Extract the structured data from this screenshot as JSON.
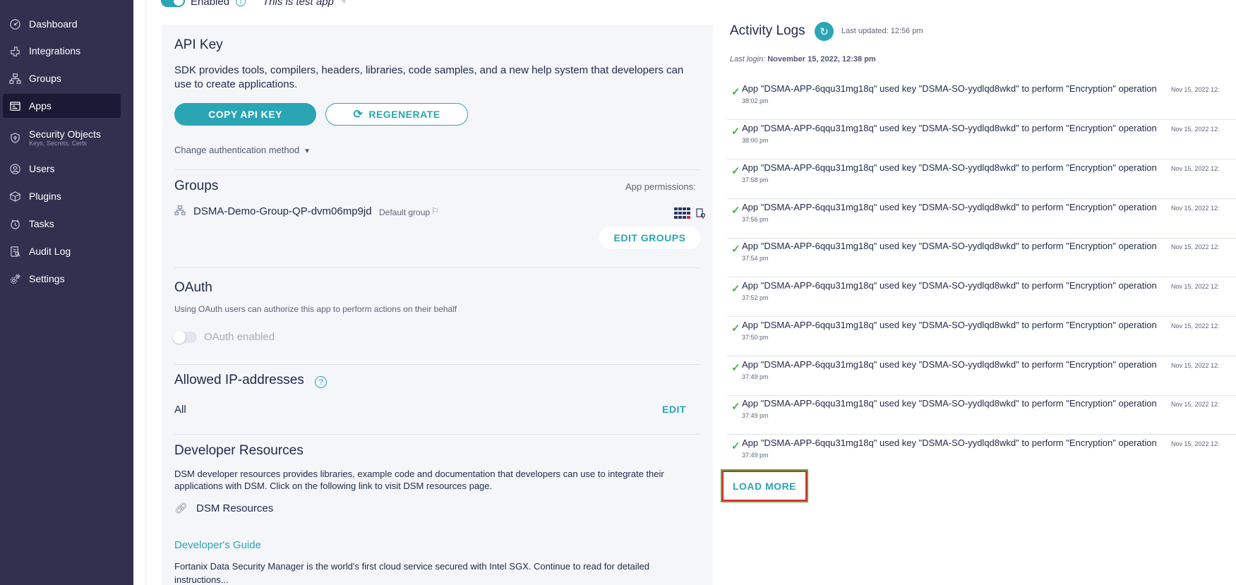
{
  "sidebar": {
    "items": [
      {
        "label": "Dashboard",
        "icon": "dashboard-icon"
      },
      {
        "label": "Integrations",
        "icon": "integrations-icon"
      },
      {
        "label": "Groups",
        "icon": "groups-icon"
      },
      {
        "label": "Apps",
        "icon": "apps-icon",
        "active": true
      },
      {
        "label": "Security Objects",
        "sublabel": "Keys, Secrets, Certs",
        "icon": "security-objects-icon"
      },
      {
        "label": "Users",
        "icon": "users-icon"
      },
      {
        "label": "Plugins",
        "icon": "plugins-icon"
      },
      {
        "label": "Tasks",
        "icon": "tasks-icon"
      },
      {
        "label": "Audit Log",
        "icon": "audit-log-icon"
      },
      {
        "label": "Settings",
        "icon": "settings-icon"
      }
    ]
  },
  "app_header": {
    "enabled_label": "Enabled",
    "description": "This is test app"
  },
  "api_key": {
    "title": "API Key",
    "description": "SDK provides tools, compilers, headers, libraries, code samples, and a new help system that developers can use to create applications.",
    "copy_label": "COPY API KEY",
    "regenerate_label": "REGENERATE",
    "change_auth_label": "Change authentication method"
  },
  "groups": {
    "title": "Groups",
    "permissions_label": "App permissions:",
    "group_name": "DSMA-Demo-Group-QP-dvm06mp9jd",
    "default_label": "Default group",
    "edit_label": "EDIT GROUPS"
  },
  "oauth": {
    "title": "OAuth",
    "description": "Using OAuth users can authorize this app to perform actions on their behalf",
    "toggle_label": "OAuth enabled"
  },
  "allowed_ip": {
    "title": "Allowed IP-addresses",
    "value": "All",
    "edit_label": "EDIT"
  },
  "developer_resources": {
    "title": "Developer Resources",
    "description": "DSM developer resources provides libraries, example code and documentation that developers can use to integrate their applications with DSM. Click on the following link to visit DSM resources page.",
    "link_label": "DSM Resources",
    "guide_title": "Developer's Guide",
    "guide_text": "Fortanix Data Security Manager is the world's first cloud service secured with Intel SGX. Continue to read for detailed instructions..."
  },
  "activity_logs": {
    "title": "Activity Logs",
    "last_updated": "Last updated: 12:56 pm",
    "last_login_label": "Last login:",
    "last_login_value": "November 15, 2022, 12:38 pm",
    "load_more_label": "LOAD MORE",
    "entries": [
      {
        "message": "App \"DSMA-APP-6qqu31mg18q\" used key \"DSMA-SO-yydlqd8wkd\" to perform \"Encryption\" operation",
        "date": "Nov 15, 2022 12:",
        "time": "38:02 pm"
      },
      {
        "message": "App \"DSMA-APP-6qqu31mg18q\" used key \"DSMA-SO-yydlqd8wkd\" to perform \"Encryption\" operation",
        "date": "Nov 15, 2022 12:",
        "time": "38:00 pm"
      },
      {
        "message": "App \"DSMA-APP-6qqu31mg18q\" used key \"DSMA-SO-yydlqd8wkd\" to perform \"Encryption\" operation",
        "date": "Nov 15, 2022 12:",
        "time": "37:58 pm"
      },
      {
        "message": "App \"DSMA-APP-6qqu31mg18q\" used key \"DSMA-SO-yydlqd8wkd\" to perform \"Encryption\" operation",
        "date": "Nov 15, 2022 12:",
        "time": "37:56 pm"
      },
      {
        "message": "App \"DSMA-APP-6qqu31mg18q\" used key \"DSMA-SO-yydlqd8wkd\" to perform \"Encryption\" operation",
        "date": "Nov 15, 2022 12:",
        "time": "37:54 pm"
      },
      {
        "message": "App \"DSMA-APP-6qqu31mg18q\" used key \"DSMA-SO-yydlqd8wkd\" to perform \"Encryption\" operation",
        "date": "Nov 15, 2022 12:",
        "time": "37:52 pm"
      },
      {
        "message": "App \"DSMA-APP-6qqu31mg18q\" used key \"DSMA-SO-yydlqd8wkd\" to perform \"Encryption\" operation",
        "date": "Nov 15, 2022 12:",
        "time": "37:50 pm"
      },
      {
        "message": "App \"DSMA-APP-6qqu31mg18q\" used key \"DSMA-SO-yydlqd8wkd\" to perform \"Encryption\" operation",
        "date": "Nov 15, 2022 12:",
        "time": "37:49 pm"
      },
      {
        "message": "App \"DSMA-APP-6qqu31mg18q\" used key \"DSMA-SO-yydlqd8wkd\" to perform \"Encryption\" operation",
        "date": "Nov 15, 2022 12:",
        "time": "37:49 pm"
      },
      {
        "message": "App \"DSMA-APP-6qqu31mg18q\" used key \"DSMA-SO-yydlqd8wkd\" to perform \"Encryption\" operation",
        "date": "Nov 15, 2022 12:",
        "time": "37:49 pm"
      }
    ]
  },
  "colors": {
    "sidebar_bg": "#332f4e",
    "sidebar_active": "#1b1933",
    "accent": "#2aa5b4",
    "success": "#4caf50",
    "highlight_outer": "#48b13f",
    "highlight_inner": "#e0262b"
  }
}
